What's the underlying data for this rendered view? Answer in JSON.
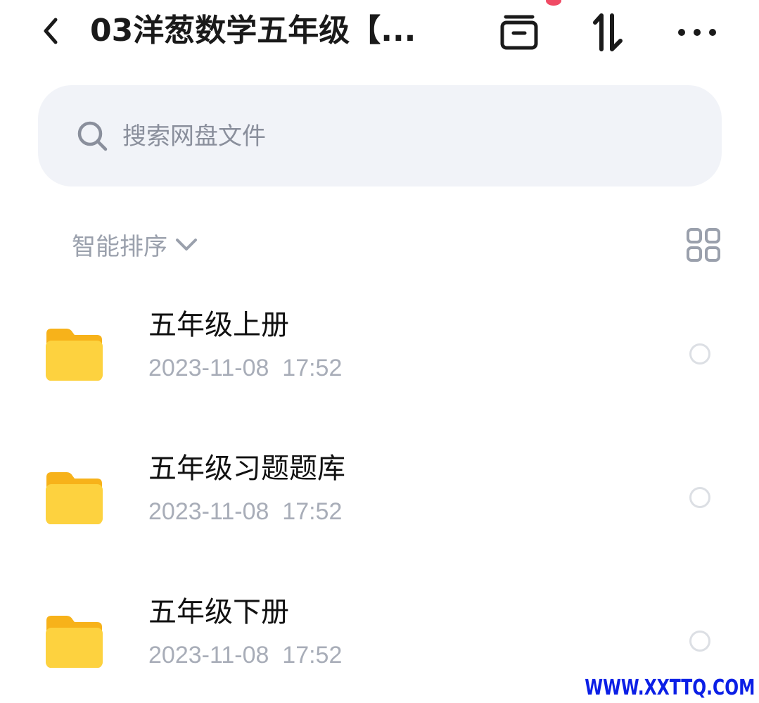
{
  "header": {
    "back_icon": "chevron-left-icon",
    "title": "03洋葱数学五年级【...",
    "actions": [
      {
        "name": "archive-icon",
        "badge": true
      },
      {
        "name": "transfer-icon"
      },
      {
        "name": "more-icon"
      }
    ],
    "badge_color": "#f04a64"
  },
  "search": {
    "icon": "search-icon",
    "placeholder": "搜索网盘文件",
    "value": ""
  },
  "sort": {
    "label": "智能排序",
    "icon": "chevron-down-icon",
    "view_toggle_icon": "grid-view-icon"
  },
  "files": [
    {
      "name": "五年级上册",
      "meta": "2023-11-08  17:52",
      "type": "folder-icon",
      "selected": false
    },
    {
      "name": "五年级习题题库",
      "meta": "2023-11-08  17:52",
      "type": "folder-icon",
      "selected": false
    },
    {
      "name": "五年级下册",
      "meta": "2023-11-08  17:52",
      "type": "folder-icon",
      "selected": false
    }
  ],
  "watermark": "WWW.XXTTQ.COM",
  "colors": {
    "folder": "#fccb2e",
    "search_bg": "#f1f3f8",
    "muted_text": "#a8adb8",
    "watermark": "#0b1fe6"
  }
}
